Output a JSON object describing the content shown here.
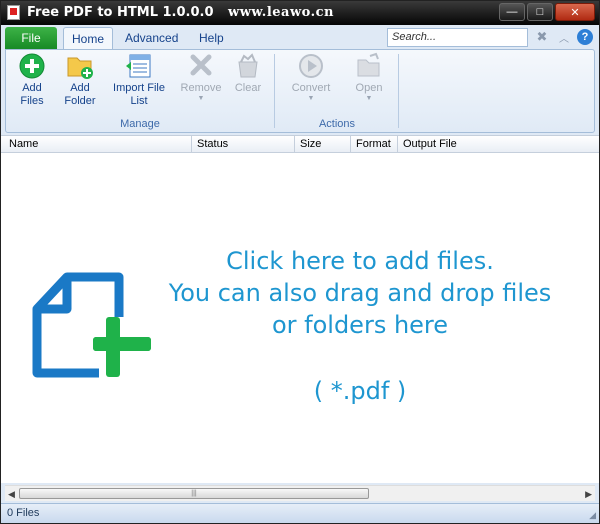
{
  "window": {
    "title": "Free PDF to HTML 1.0.0.0",
    "watermark": "www.leawo.cn",
    "controls": {
      "minimize": "—",
      "maximize": "□",
      "close": "✕"
    }
  },
  "tabs": {
    "file": "File",
    "items": [
      {
        "label": "Home",
        "active": true
      },
      {
        "label": "Advanced",
        "active": false
      },
      {
        "label": "Help",
        "active": false
      }
    ]
  },
  "search": {
    "placeholder": "Search..."
  },
  "ribbon": {
    "manage": {
      "label": "Manage",
      "buttons": {
        "add_files": "Add\nFiles",
        "add_folder": "Add\nFolder",
        "import_list": "Import File\nList",
        "remove": "Remove",
        "clear": "Clear"
      }
    },
    "actions": {
      "label": "Actions",
      "buttons": {
        "convert": "Convert",
        "open": "Open"
      }
    }
  },
  "columns": [
    "Name",
    "Status",
    "Size",
    "Format",
    "Output File"
  ],
  "drop": {
    "line1": "Click here to add files.",
    "line2": "You can also drag and drop files",
    "line3": "or folders here",
    "ext": "( *.pdf )"
  },
  "status": {
    "count": "0 Files"
  },
  "colors": {
    "accent_green": "#1fb24a",
    "drop_blue": "#1e96d0",
    "icon_blue": "#1a79c6"
  }
}
